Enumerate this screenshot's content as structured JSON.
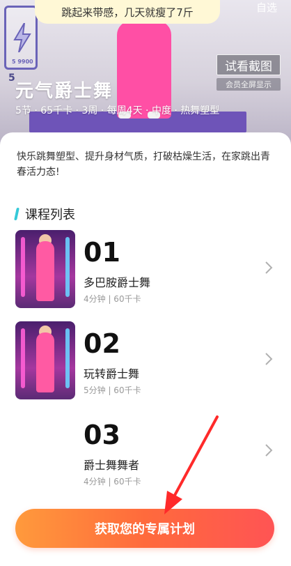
{
  "header": {
    "banner_text": "跳起来带感，几天就瘦了7斤",
    "top_right_label": "自选",
    "trial_button_label": "试看截图",
    "trial_subtitle": "会员全屏显示",
    "badge_text": "5 ",
    "poster_battery_text": "5 9900"
  },
  "course": {
    "title": "元气爵士舞",
    "meta": "5节 · 65千卡 · 3周 · 每周4天 · 中度 · 热舞塑型",
    "description": "快乐跳舞塑型、提升身材气质，打破枯燥生活，在家跳出青春活力态!"
  },
  "section": {
    "title": "课程列表"
  },
  "lessons": [
    {
      "number": "01",
      "name": "多巴胺爵士舞",
      "meta": "4分钟 | 60千卡"
    },
    {
      "number": "02",
      "name": "玩转爵士舞",
      "meta": "5分钟 | 60千卡"
    },
    {
      "number": "03",
      "name": "爵士舞舞者",
      "meta": "4分钟 | 60千卡"
    }
  ],
  "cta": {
    "label": "获取您的专属计划"
  },
  "colors": {
    "accent": "#35c9d8",
    "cta_start": "#ff9a3c",
    "cta_end": "#ff5454",
    "annotation_arrow": "#ff2a2a"
  },
  "icons": [
    "lightning-icon",
    "chevron-right-icon"
  ]
}
